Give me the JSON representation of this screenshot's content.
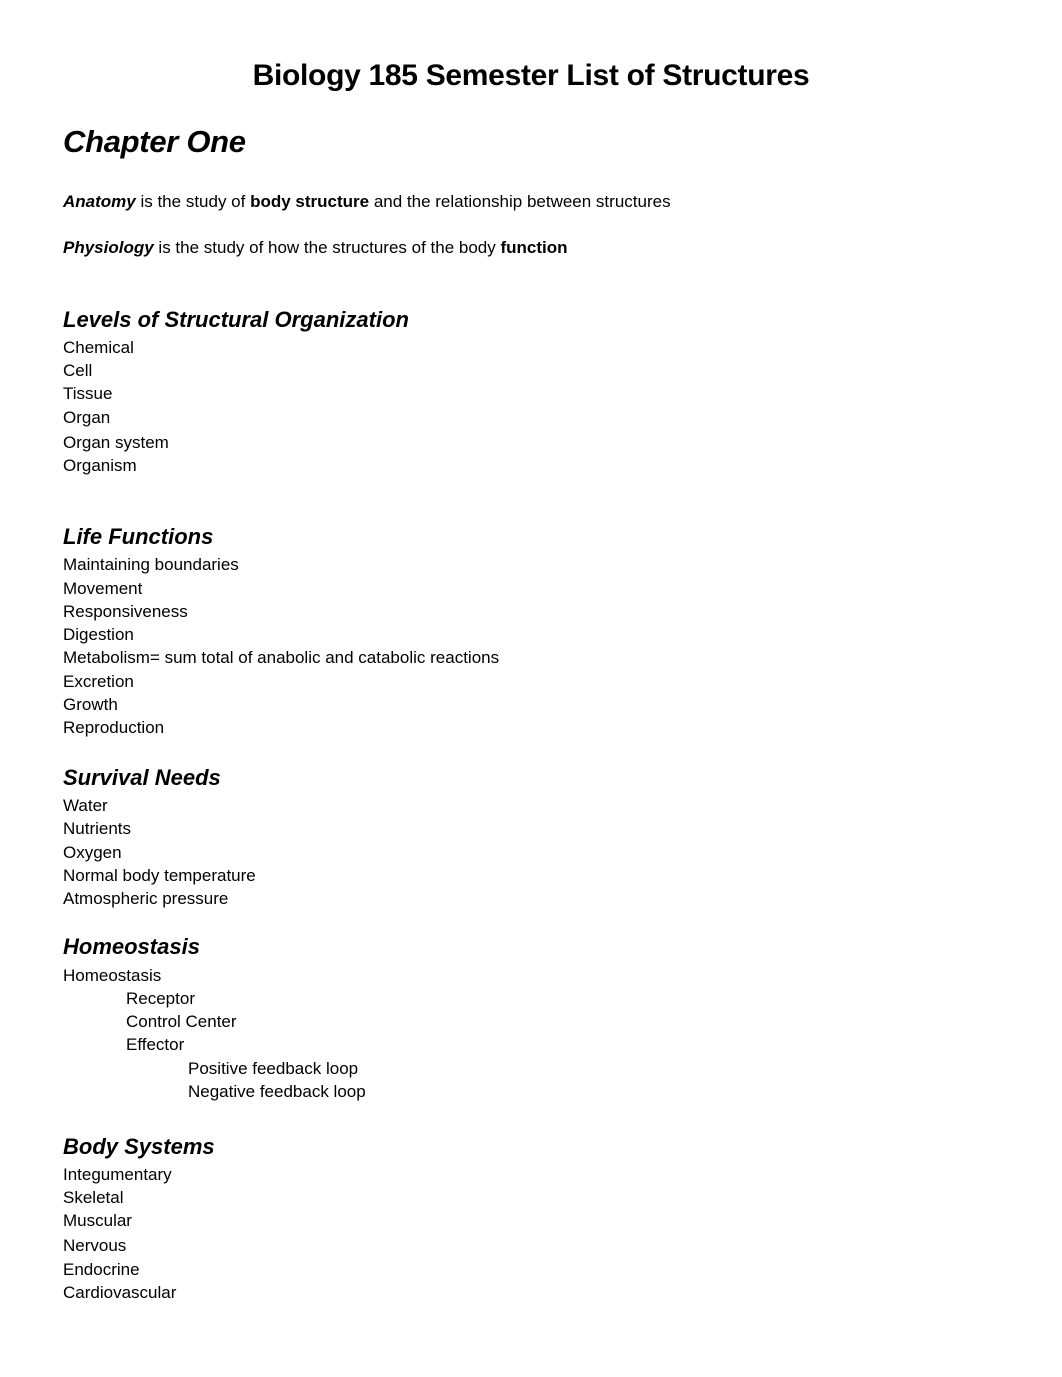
{
  "document": {
    "title": "Biology 185 Semester List of Structures",
    "chapter": "Chapter One",
    "definitions": {
      "anatomy": {
        "term": "Anatomy",
        "text1": " is the study of ",
        "emphasis": "body structure",
        "text2": " and the relationship between structures"
      },
      "physiology": {
        "term": "Physiology",
        "text1": " is the study of how the structures of the body ",
        "emphasis": "function"
      }
    },
    "sections": {
      "levels": {
        "heading": "Levels of Structural Organization",
        "items": [
          "Chemical",
          "Cell",
          "Tissue",
          "Organ",
          "Organ system",
          "Organism"
        ]
      },
      "life_functions": {
        "heading": "Life Functions",
        "items": [
          "Maintaining boundaries",
          "Movement",
          "Responsiveness",
          "Digestion",
          "Metabolism= sum total of anabolic and catabolic reactions",
          "Excretion",
          "Growth",
          "Reproduction"
        ]
      },
      "survival_needs": {
        "heading": "Survival Needs",
        "items": [
          "Water",
          "Nutrients",
          "Oxygen",
          "Normal body temperature",
          "Atmospheric pressure"
        ]
      },
      "homeostasis": {
        "heading": "Homeostasis",
        "items": [
          "Homeostasis",
          "Receptor",
          "Control Center",
          "Effector",
          "Positive feedback loop",
          "Negative feedback loop"
        ]
      },
      "body_systems": {
        "heading": "Body Systems",
        "items": [
          "Integumentary",
          "Skeletal",
          "Muscular",
          "Nervous",
          "Endocrine",
          "Cardiovascular"
        ]
      }
    }
  }
}
